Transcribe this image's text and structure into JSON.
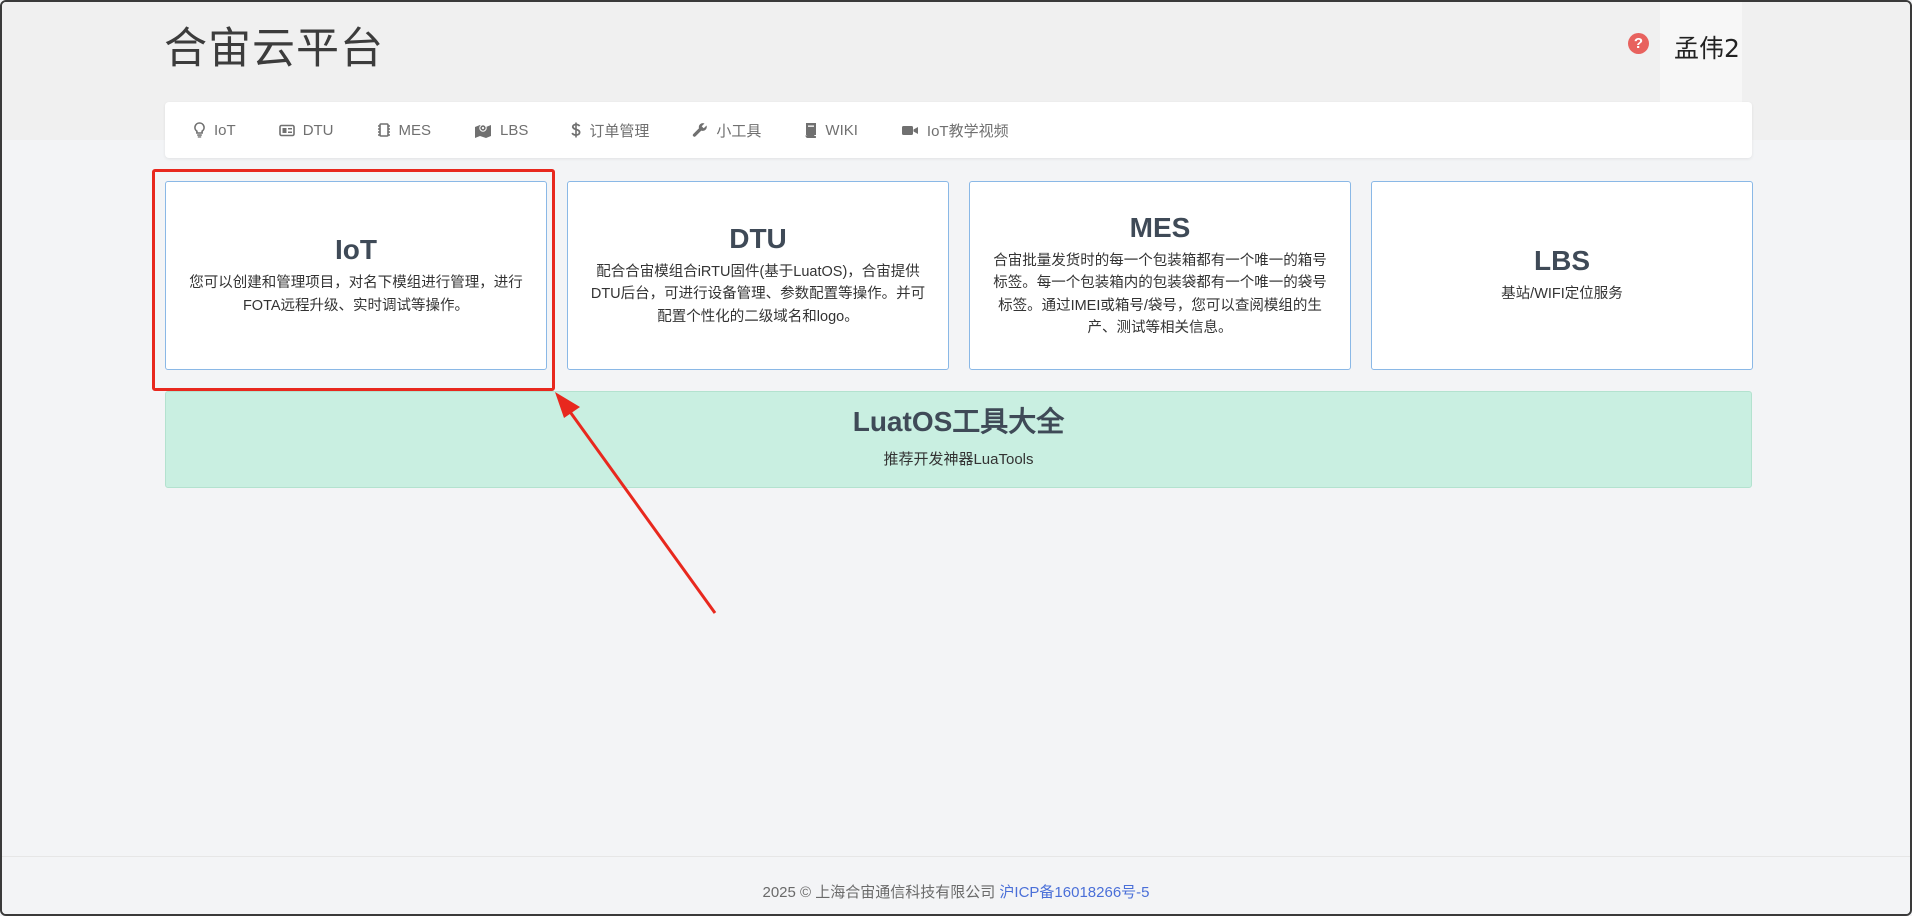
{
  "header": {
    "title": "合宙云平台",
    "user_name": "孟伟2",
    "help_symbol": "?"
  },
  "nav": {
    "items": [
      {
        "label": "IoT",
        "icon": "lightbulb-icon"
      },
      {
        "label": "DTU",
        "icon": "device-icon"
      },
      {
        "label": "MES",
        "icon": "chip-icon"
      },
      {
        "label": "LBS",
        "icon": "map-icon"
      },
      {
        "label": "订单管理",
        "icon": "dollar-icon"
      },
      {
        "label": "小工具",
        "icon": "wrench-icon"
      },
      {
        "label": "WIKI",
        "icon": "book-icon"
      },
      {
        "label": "IoT教学视频",
        "icon": "video-icon"
      }
    ]
  },
  "cards": [
    {
      "title": "IoT",
      "desc": "您可以创建和管理项目，对名下模组进行管理，进行FOTA远程升级、实时调试等操作。"
    },
    {
      "title": "DTU",
      "desc": "配合合宙模组合iRTU固件(基于LuatOS)，合宙提供DTU后台，可进行设备管理、参数配置等操作。并可配置个性化的二级域名和logo。"
    },
    {
      "title": "MES",
      "desc": "合宙批量发货时的每一个包装箱都有一个唯一的箱号标签。每一个包装箱内的包装袋都有一个唯一的袋号标签。通过IMEI或箱号/袋号，您可以查阅模组的生产、测试等相关信息。"
    },
    {
      "title": "LBS",
      "desc": "基站/WIFI定位服务"
    }
  ],
  "tools": {
    "title": "LuatOS工具大全",
    "subtitle": "推荐开发神器LuaTools"
  },
  "footer": {
    "copyright": "2025 © 上海合宙通信科技有限公司 ",
    "icp": "沪ICP备16018266号-5"
  },
  "colors": {
    "accent_border": "#8ab8e6",
    "highlight": "#e8281e",
    "banner_bg": "#c9efe1",
    "help": "#e8625e",
    "link": "#4a6fd8"
  }
}
